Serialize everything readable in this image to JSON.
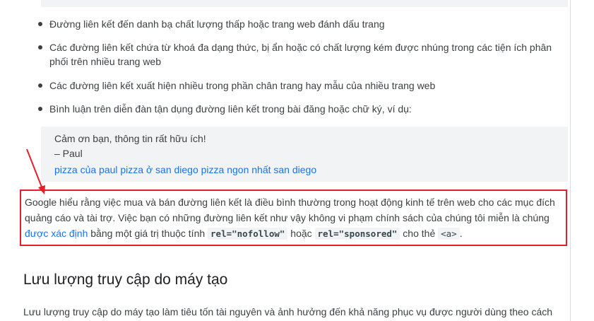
{
  "bullets": [
    "Đường liên kết đến danh bạ chất lượng thấp hoặc trang web đánh dấu trang",
    "Các đường liên kết chứa từ khoá đa dạng thức, bị ẩn hoặc có chất lượng kém được nhúng trong các tiện ích phân phối trên nhiều trang web",
    "Các đường liên kết xuất hiện nhiều trong phần chân trang hay mẫu của nhiều trang web",
    "Bình luận trên diễn đàn tận dụng đường liên kết trong bài đăng hoặc chữ ký, ví dụ:"
  ],
  "quote": {
    "line1": "Cảm ơn bạn, thông tin rất hữu ích!",
    "line2": "– Paul",
    "link": "pizza của paul pizza ở san diego pizza ngon nhất san diego"
  },
  "highlight": {
    "text_before_link": "Google hiểu rằng việc mua và bán đường liên kết là điều bình thường trong hoạt động kinh tế trên web cho các mục đích quảng cáo và tài trợ. Việc bạn có những đường liên kết như vậy không vi phạm chính sách của chúng tôi miễn là chúng ",
    "link_text": "được xác định",
    "text_after_link": " bằng một giá trị thuộc tính ",
    "code1": "rel=\"nofollow\"",
    "text_mid": " hoặc ",
    "code2": "rel=\"sponsored\"",
    "text_tag": " cho thẻ ",
    "code3": "<a>",
    "text_end": "."
  },
  "section": {
    "heading": "Lưu lượng truy cập do máy tạo",
    "paragraph": "Lưu lượng truy cập do máy tạo làm tiêu tốn tài nguyên và ảnh hưởng đến khả năng phục vụ được người dùng theo cách"
  },
  "colors": {
    "annotation_red": "#e6202a",
    "link_blue": "#1a73e8",
    "quote_bg": "#f1f3f4"
  }
}
